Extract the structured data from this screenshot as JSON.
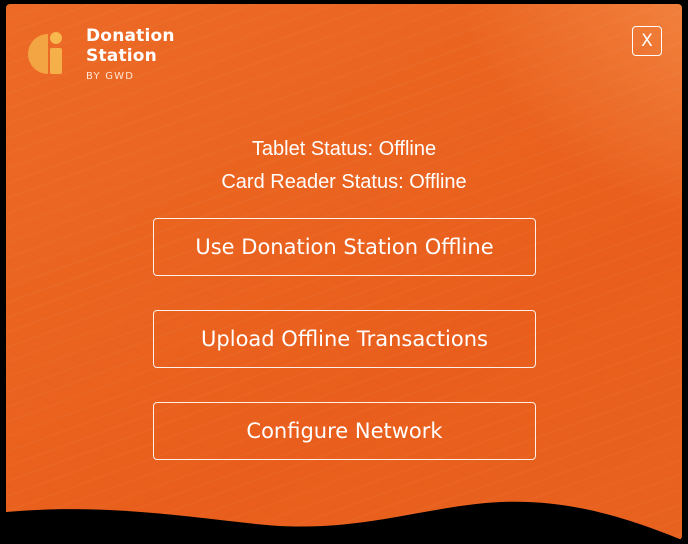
{
  "logo": {
    "line1": "Donation",
    "line2": "Station",
    "byline": "BY GWD",
    "icon": "donation-station-logo-icon",
    "colors": {
      "mark": "#f3a544",
      "dot": "#f8b84e"
    }
  },
  "close_button": {
    "label": "X"
  },
  "status": {
    "tablet": "Tablet Status: Offline",
    "card_reader": "Card Reader Status: Offline"
  },
  "actions": [
    {
      "label": "Use Donation Station Offline"
    },
    {
      "label": "Upload Offline Transactions"
    },
    {
      "label": "Configure Network"
    }
  ],
  "colors": {
    "background": "#e9621f",
    "text": "#ffffff"
  }
}
